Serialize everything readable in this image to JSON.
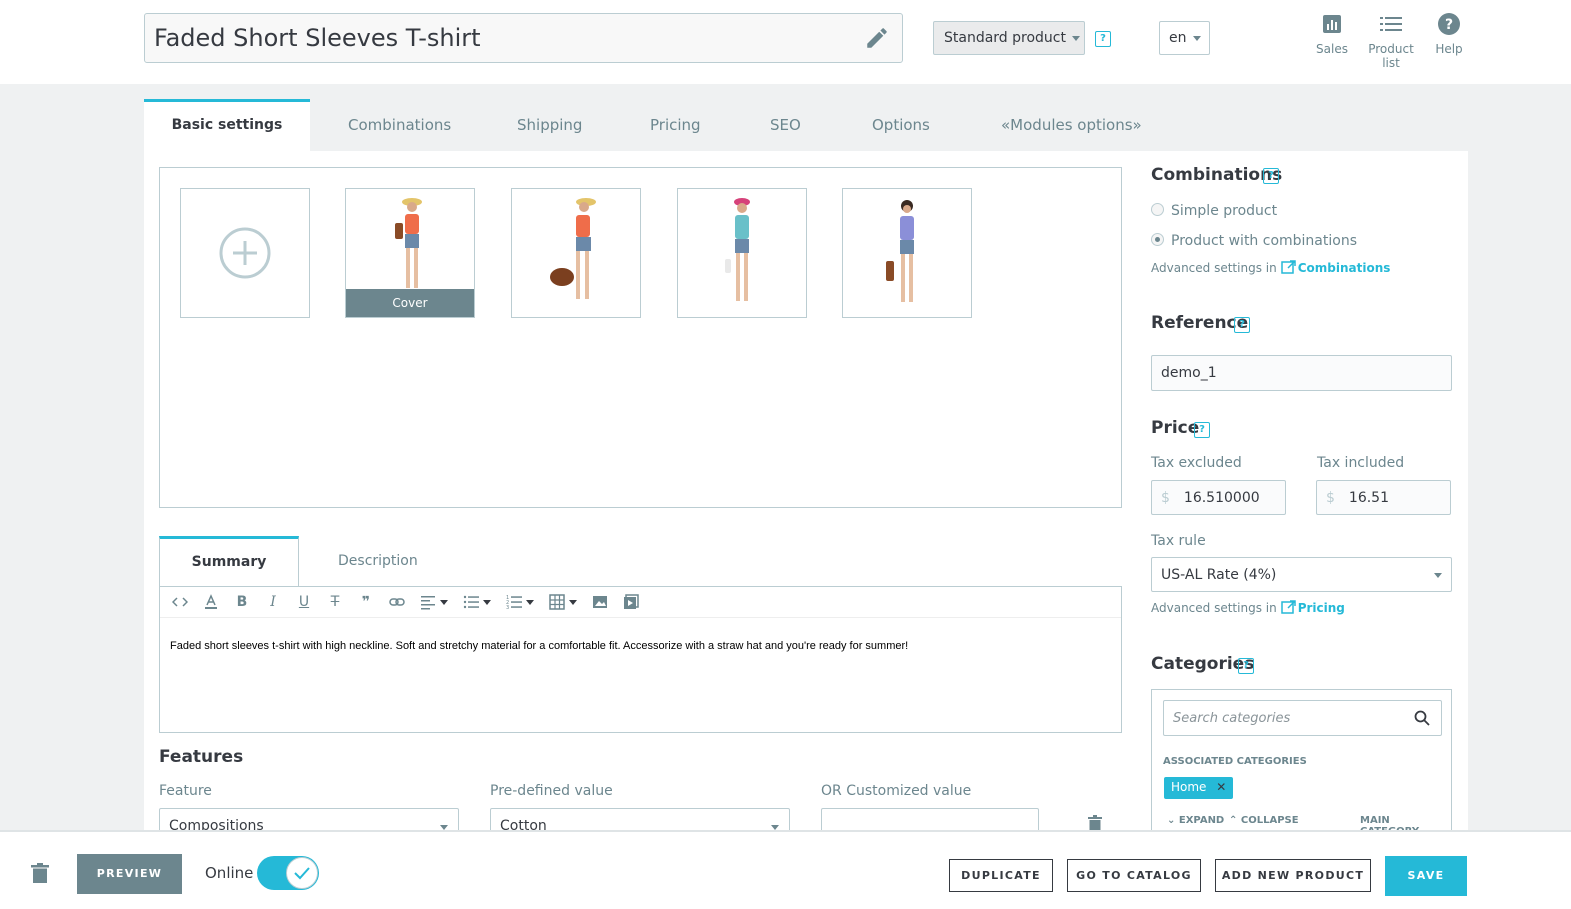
{
  "header": {
    "product_name": "Faded Short Sleeves T-shirt",
    "product_type": "Standard product",
    "language": "en",
    "links": [
      {
        "label": "Sales",
        "icon": "bar-chart-icon"
      },
      {
        "label": "Product list",
        "icon": "list-icon"
      },
      {
        "label": "Help",
        "icon": "help-circle-icon"
      }
    ]
  },
  "tabs": [
    "Basic settings",
    "Combinations",
    "Shipping",
    "Pricing",
    "SEO",
    "Options",
    "«Modules options»"
  ],
  "images": {
    "cover_label": "Cover",
    "add_icon": "add-image-icon"
  },
  "editor": {
    "tabs": [
      "Summary",
      "Description"
    ],
    "summary_text": "Faded short sleeves t-shirt with high neckline. Soft and stretchy material for a comfortable fit. Accessorize with a straw hat and you're ready for summer!"
  },
  "features": {
    "title": "Features",
    "labels": [
      "Feature",
      "Pre-defined value",
      "OR Customized value"
    ],
    "feature_value": "Compositions",
    "predefined_value": "Cotton",
    "custom_value": ""
  },
  "right": {
    "combinations_title": "Combinations",
    "simple_product": "Simple product",
    "product_with_combinations": "Product with combinations",
    "advanced_settings_in": "Advanced settings in",
    "combinations_link": "Combinations",
    "reference_title": "Reference",
    "reference_value": "demo_1",
    "price_title": "Price",
    "tax_excluded_label": "Tax excluded",
    "tax_included_label": "Tax included",
    "currency": "$",
    "tax_excluded_value": "16.510000",
    "tax_included_value": "16.51",
    "tax_rule_label": "Tax rule",
    "tax_rule_value": "US-AL Rate (4%)",
    "pricing_link": "Pricing",
    "categories_title": "Categories",
    "search_placeholder": "Search categories",
    "associated_categories": "ASSOCIATED CATEGORIES",
    "category_chip": "Home",
    "expand": "EXPAND",
    "collapse": "COLLAPSE",
    "main_category": "MAIN CATEGORY"
  },
  "footer": {
    "preview": "PREVIEW",
    "online": "Online",
    "duplicate": "DUPLICATE",
    "go_to_catalog": "GO TO CATALOG",
    "add_new_product": "ADD NEW PRODUCT",
    "save": "SAVE"
  },
  "colors": {
    "accent": "#25b9d7",
    "muted": "#6c868e",
    "border": "#bbcdd2"
  }
}
